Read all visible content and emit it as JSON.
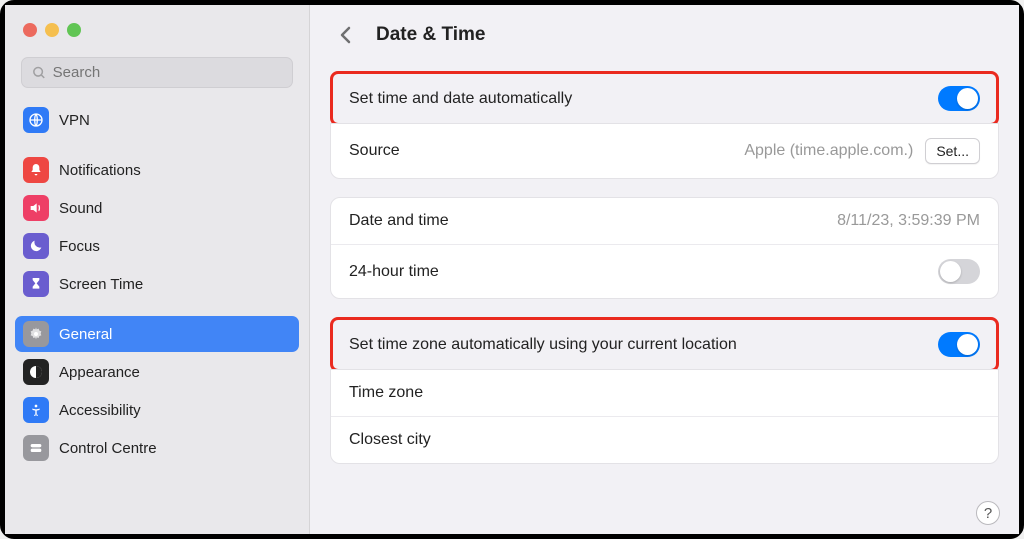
{
  "search": {
    "placeholder": "Search"
  },
  "sidebar": {
    "items": [
      {
        "label": "VPN",
        "icon_bg": "#2f7af6",
        "glyph": "globe"
      },
      {
        "label": "Notifications",
        "icon_bg": "#ee4742",
        "glyph": "bell"
      },
      {
        "label": "Sound",
        "icon_bg": "#ee3f66",
        "glyph": "speaker"
      },
      {
        "label": "Focus",
        "icon_bg": "#6a5dcf",
        "glyph": "moon"
      },
      {
        "label": "Screen Time",
        "icon_bg": "#6a5dcf",
        "glyph": "hourglass"
      },
      {
        "label": "General",
        "icon_bg": "#98989d",
        "glyph": "gear"
      },
      {
        "label": "Appearance",
        "icon_bg": "#232323",
        "glyph": "contrast"
      },
      {
        "label": "Accessibility",
        "icon_bg": "#2f7af6",
        "glyph": "person"
      },
      {
        "label": "Control Centre",
        "icon_bg": "#98989d",
        "glyph": "toggles"
      }
    ],
    "selected_index": 5
  },
  "header": {
    "title": "Date & Time"
  },
  "rows": {
    "auto_time_label": "Set time and date automatically",
    "auto_time_on": true,
    "source_label": "Source",
    "source_value": "Apple (time.apple.com.)",
    "set_button": "Set...",
    "date_time_label": "Date and time",
    "date_time_value": "8/11/23, 3:59:39 PM",
    "hour24_label": "24-hour time",
    "hour24_on": false,
    "auto_tz_label": "Set time zone automatically using your current location",
    "auto_tz_on": true,
    "tz_label": "Time zone",
    "tz_value": "",
    "city_label": "Closest city",
    "city_value": ""
  },
  "help_label": "?"
}
